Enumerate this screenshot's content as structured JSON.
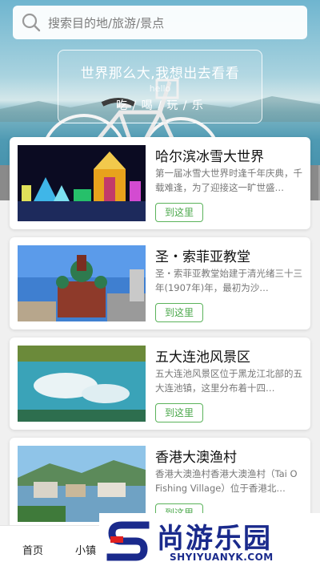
{
  "search": {
    "placeholder": "搜索目的地/旅游/景点"
  },
  "slogan": {
    "line1": "世界那么大,我想出去看看",
    "line2": "hello",
    "line3": "吃 / 喝 / 玩 / 乐"
  },
  "cards": [
    {
      "title": "哈尔滨冰雪大世界",
      "desc": "第一届冰雪大世界时逢千年庆典，千载难逢，为了迎接这一旷世盛…",
      "button": "到这里",
      "thumb": "ice-festival"
    },
    {
      "title": "圣・索菲亚教堂",
      "desc": "圣・索菲亚教堂始建于清光绪三十三年(1907年)年，最初为沙…",
      "button": "到这里",
      "thumb": "cathedral"
    },
    {
      "title": "五大连池风景区",
      "desc": "五大连池风景区位于黑龙江北部的五大连池镇，这里分布着十四…",
      "button": "到这里",
      "thumb": "lake"
    },
    {
      "title": "香港大澳渔村",
      "desc": "香港大澳渔村香港大澳渔村（Tai O Fishing Village）位于香港北…",
      "button": "到这里",
      "thumb": "fishing-village"
    }
  ],
  "nav": {
    "items": [
      "首页",
      "小镇"
    ]
  },
  "watermark": {
    "brand": "尚游乐园",
    "domain": "SHYIYUANYK.COM"
  },
  "colors": {
    "accent": "#4ba84b",
    "brand": "#1a2a8c"
  }
}
